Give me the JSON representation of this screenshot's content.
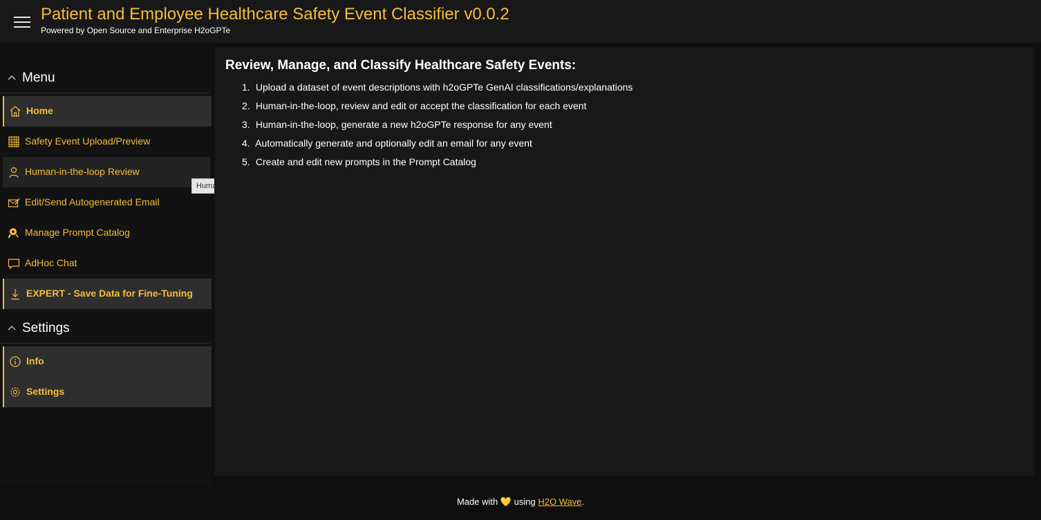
{
  "header": {
    "title": "Patient and Employee Healthcare Safety Event Classifier v0.0.2",
    "subtitle": "Powered by Open Source and Enterprise H2oGPTe",
    "accent_color": "#f5bd3c"
  },
  "sidebar": {
    "menu_section": {
      "label": "Menu",
      "items": [
        {
          "label": "Home",
          "icon": "home-icon",
          "active": true
        },
        {
          "label": "Safety Event Upload/Preview",
          "icon": "table-grid-icon",
          "active": false
        },
        {
          "label": "Human-in-the-loop Review",
          "icon": "person-icon",
          "active": false,
          "hovered": true
        },
        {
          "label": "Edit/Send Autogenerated Email",
          "icon": "mail-edit-icon",
          "active": false
        },
        {
          "label": "Manage Prompt Catalog",
          "icon": "search-key-icon",
          "active": false
        },
        {
          "label": "AdHoc Chat",
          "icon": "chat-icon",
          "active": false
        },
        {
          "label": "EXPERT - Save Data for Fine-Tuning",
          "icon": "download-icon",
          "active": true
        }
      ]
    },
    "settings_section": {
      "label": "Settings",
      "items": [
        {
          "label": "Info",
          "icon": "info-icon",
          "active": true
        },
        {
          "label": "Settings",
          "icon": "gear-icon",
          "active": true
        }
      ]
    }
  },
  "tooltip": {
    "text": "Human-in-the-loop Review"
  },
  "main": {
    "title": "Review, Manage, and Classify Healthcare Safety Events:",
    "steps": [
      {
        "num": "1.",
        "text": "Upload a dataset of event descriptions with h2oGPTe GenAI classifications/explanations"
      },
      {
        "num": "2.",
        "text": "Human-in-the-loop, review and edit or accept the classification for each event"
      },
      {
        "num": "3.",
        "text": "Human-in-the-loop, generate a new h2oGPTe response for any event"
      },
      {
        "num": "4.",
        "text": "Automatically generate and optionally edit an email for any event"
      },
      {
        "num": "5.",
        "text": "Create and edit new prompts in the Prompt Catalog"
      }
    ]
  },
  "footer": {
    "prefix": "Made with",
    "heart": "💛",
    "middle": "using",
    "link_text": "H2O Wave",
    "suffix": "."
  }
}
